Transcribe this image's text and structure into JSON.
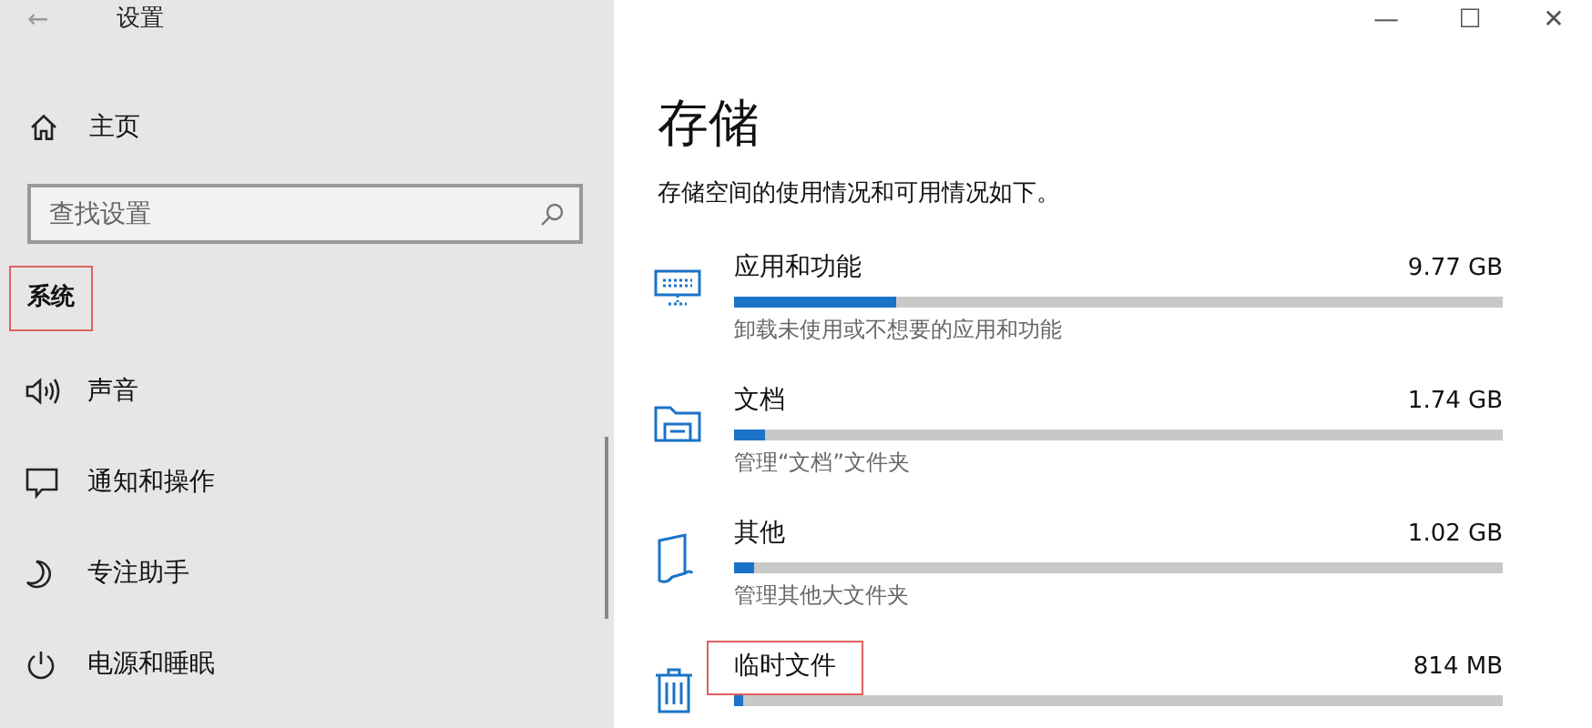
{
  "window": {
    "title": "设置",
    "back": "←",
    "controls": [
      "—",
      "☐",
      "✕"
    ]
  },
  "sidebar": {
    "home": {
      "label": "主页"
    },
    "search": {
      "placeholder": "查找设置"
    },
    "section": {
      "label": "系统",
      "highlighted": true
    },
    "items": [
      {
        "label": "声音",
        "kind": "sound"
      },
      {
        "label": "通知和操作",
        "kind": "message"
      },
      {
        "label": "专注助手",
        "kind": "moon"
      },
      {
        "label": "电源和睡眠",
        "kind": "power"
      }
    ]
  },
  "content": {
    "title": "存储",
    "description": "存储空间的使用情况和可用情况如下。",
    "items": [
      {
        "kind": "apps",
        "name": "应用和功能",
        "size": "9.77 GB",
        "level": 0.21,
        "hint": "卸载未使用或不想要的应用和功能",
        "highlighted": false
      },
      {
        "kind": "documents",
        "name": "文档",
        "size": "1.74 GB",
        "level": 0.04,
        "hint": "管理“文档”文件夹",
        "highlighted": false
      },
      {
        "kind": "other",
        "name": "其他",
        "size": "1.02 GB",
        "level": 0.025,
        "hint": "管理其他大文件夹",
        "highlighted": false
      },
      {
        "kind": "temp",
        "name": "临时文件",
        "size": "814 MB",
        "level": 0.012,
        "highlighted": true
      }
    ]
  }
}
